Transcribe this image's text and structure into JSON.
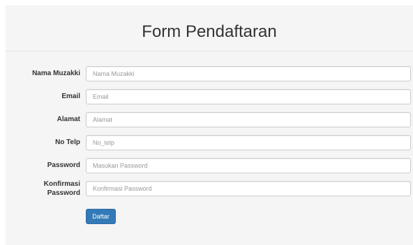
{
  "form": {
    "title": "Form Pendaftaran",
    "fields": [
      {
        "label": "Nama Muzakki",
        "placeholder": "Nama Muzakki",
        "value": ""
      },
      {
        "label": "Email",
        "placeholder": "Email",
        "value": ""
      },
      {
        "label": "Alamat",
        "placeholder": "Alamat",
        "value": ""
      },
      {
        "label": "No Telp",
        "placeholder": "No_telp",
        "value": ""
      },
      {
        "label": "Password",
        "placeholder": "Masukan Password",
        "value": ""
      },
      {
        "label_line1": "Konfirmasi",
        "label_line2": "Password",
        "placeholder": "Konfirmasi Password",
        "value": ""
      }
    ],
    "submit_label": "Daftar"
  }
}
